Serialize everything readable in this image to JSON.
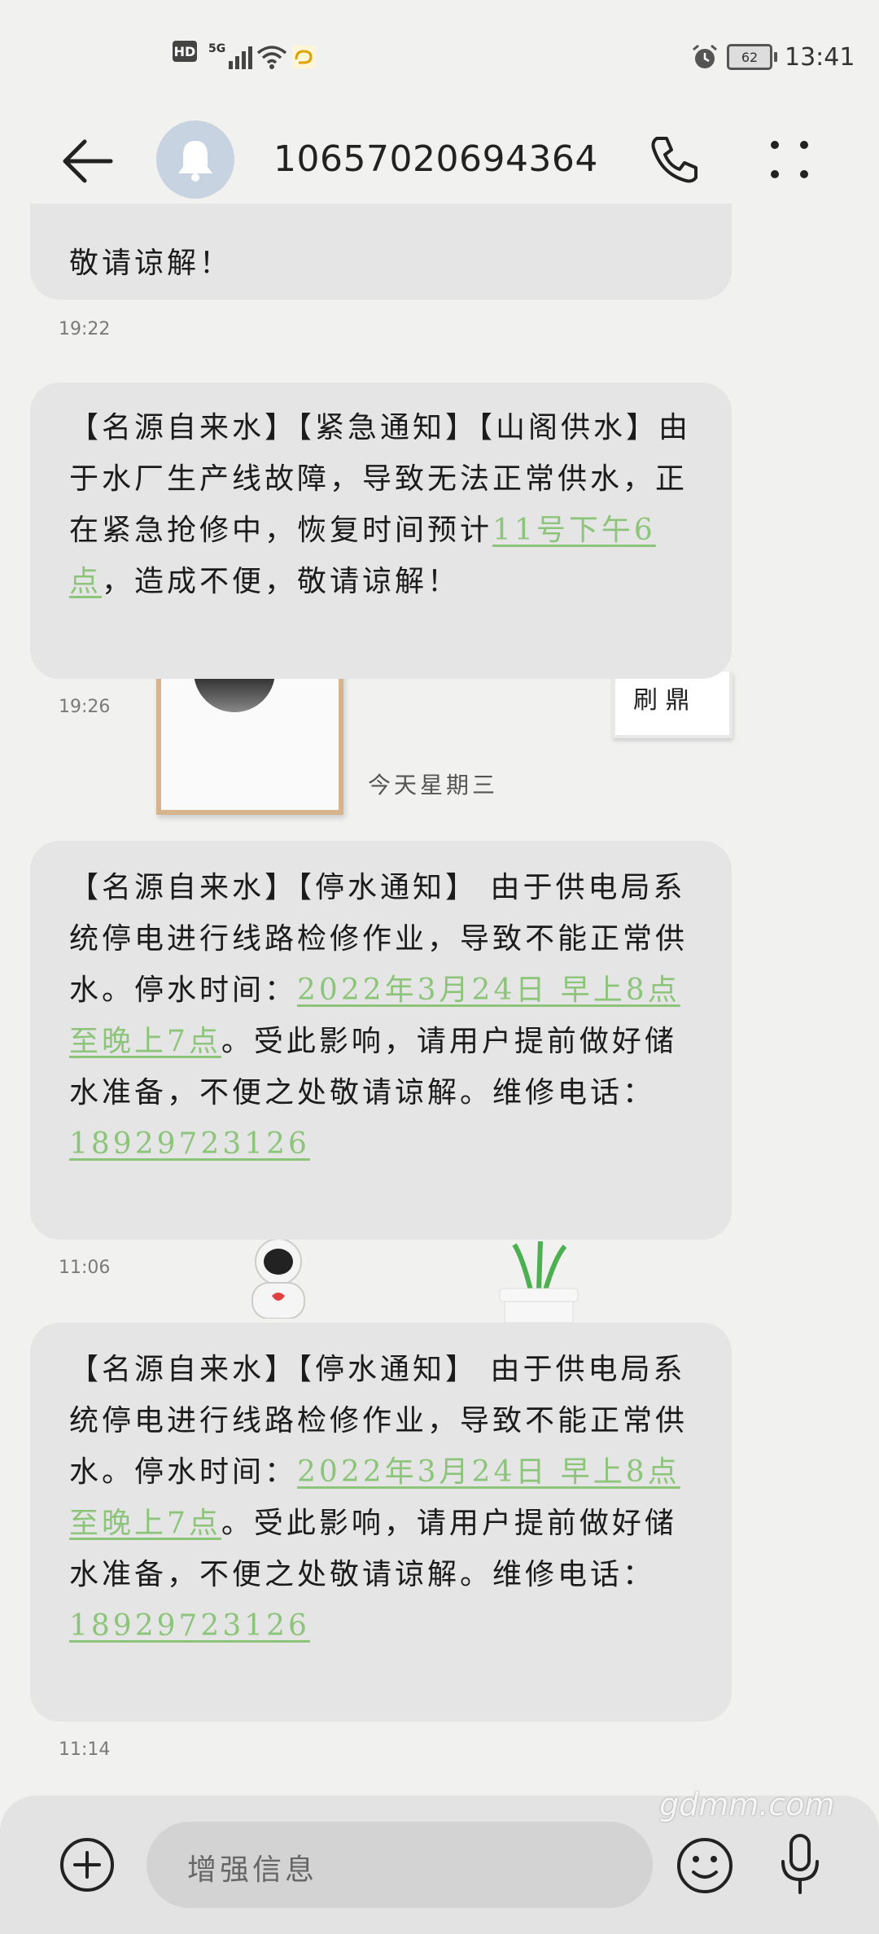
{
  "status": {
    "hd": "HD",
    "network": "5G",
    "battery": "62",
    "time": "13:41"
  },
  "header": {
    "contact": "10657020694364"
  },
  "messages": [
    {
      "segments": [
        {
          "text": "敬请谅解！"
        }
      ],
      "time": "19:22"
    },
    {
      "segments": [
        {
          "text": "【名源自来水】【紧急通知】【山阁供水】由于水厂生产线故障，导致无法正常供水，正在紧急抢修中，恢复时间预计"
        },
        {
          "text": "11号下午6点",
          "link": true
        },
        {
          "text": "，造成不便，敬请谅解！"
        }
      ],
      "time": "19:26"
    },
    {
      "segments": [
        {
          "text": "【名源自来水】【停水通知】 由于供电局系统停电进行线路检修作业，导致不能正常供水。停水时间："
        },
        {
          "text": "2022年3月24日 早上8点至晚上7点",
          "link": true
        },
        {
          "text": "。受此影响，请用户提前做好储水准备，不便之处敬请谅解。维修电话："
        },
        {
          "text": "18929723126",
          "link": true
        }
      ],
      "time": "11:06"
    },
    {
      "segments": [
        {
          "text": "【名源自来水】【停水通知】 由于供电局系统停电进行线路检修作业，导致不能正常供水。停水时间："
        },
        {
          "text": "2022年3月24日 早上8点至晚上7点",
          "link": true
        },
        {
          "text": "。受此影响，请用户提前做好储水准备，不便之处敬请谅解。维修电话："
        },
        {
          "text": "18929723126",
          "link": true
        }
      ],
      "time": "11:14"
    }
  ],
  "divider": "今天星期三",
  "decor": {
    "frame2_text": "刷 鼎"
  },
  "composer": {
    "placeholder": "增强信息"
  },
  "watermark": "gdmm.com",
  "colors": {
    "link": "#8cc57a",
    "bubble": "#e5e5e5",
    "avatar": "#c7d3e1"
  }
}
